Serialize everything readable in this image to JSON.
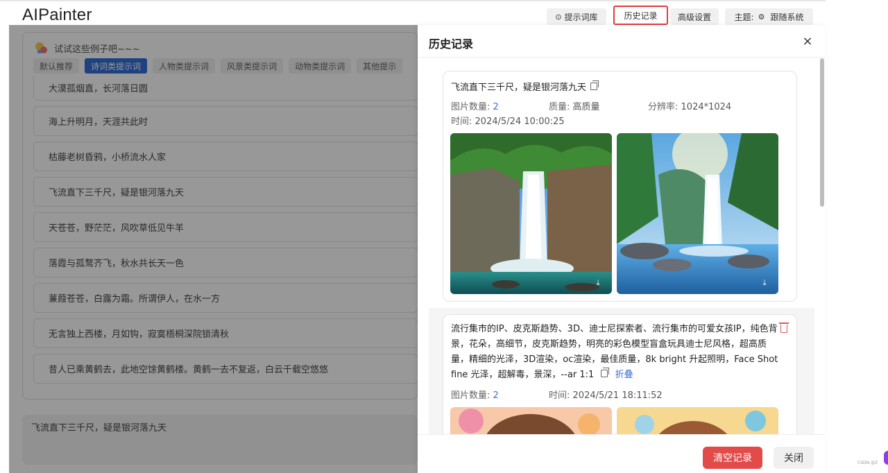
{
  "app": {
    "title": "AIPainter"
  },
  "topbar": {
    "prompt_lib": "提示词库",
    "history": "历史记录",
    "advanced": "高级设置",
    "theme_label": "主题:",
    "theme_value": "跟随系统"
  },
  "examples": {
    "heading": "试试这些例子吧~~~",
    "tabs": [
      "默认推荐",
      "诗词类提示词",
      "人物类提示词",
      "风景类提示词",
      "动物类提示词",
      "其他提示"
    ],
    "active_tab": "诗词类提示词",
    "items": [
      "大漠孤烟直，长河落日圆",
      "海上升明月，天涯共此时",
      "枯藤老树昏鸦，小桥流水人家",
      "飞流直下三千尺，疑是银河落九天",
      "天苍苍，野茫茫，风吹草低见牛羊",
      "落霞与孤鹜齐飞，秋水共长天一色",
      "蒹葭苍苍，白露为霜。所谓伊人，在水一方",
      "无言独上西楼，月如钩，寂寞梧桐深院锁清秋",
      "昔人已乘黄鹤去，此地空馀黄鹤楼。黄鹤一去不复返，白云千载空悠悠"
    ]
  },
  "input": {
    "value": "飞流直下三千尺，疑是银河落九天"
  },
  "drawer": {
    "title": "历史记录",
    "records": [
      {
        "prompt": "飞流直下三千尺，疑是银河落九天",
        "count_label": "图片数量:",
        "count": "2",
        "quality_label": "质量:",
        "quality": "高质量",
        "resolution_label": "分辨率:",
        "resolution": "1024*1024",
        "time_label": "时间:",
        "time": "2024/5/24 10:00:25"
      },
      {
        "prompt": "流行集市的IP、皮克斯趋势、3D、迪士尼探索者、流行集市的可爱女孩IP，纯色背景，花朵，高细节，皮克斯趋势，明亮的彩色模型盲盒玩具迪士尼风格，超高质量，精细的光泽，3D渲染，oc渲染，最佳质量，8k bright 升起照明，Face Shot fine 光泽，超解毒，景深，--ar 1:1",
        "fold": "折叠",
        "count_label": "图片数量:",
        "count": "2",
        "time_label": "时间:",
        "time": "2024/5/21 18:11:52"
      }
    ],
    "clear_button": "清空记录",
    "close_button": "关闭"
  },
  "watermark": "CSDN @Z",
  "colors": {
    "primary": "#1f5fd1",
    "danger": "#e34b4b",
    "highlight": "#e33a3a",
    "link": "#3a6fd8"
  }
}
